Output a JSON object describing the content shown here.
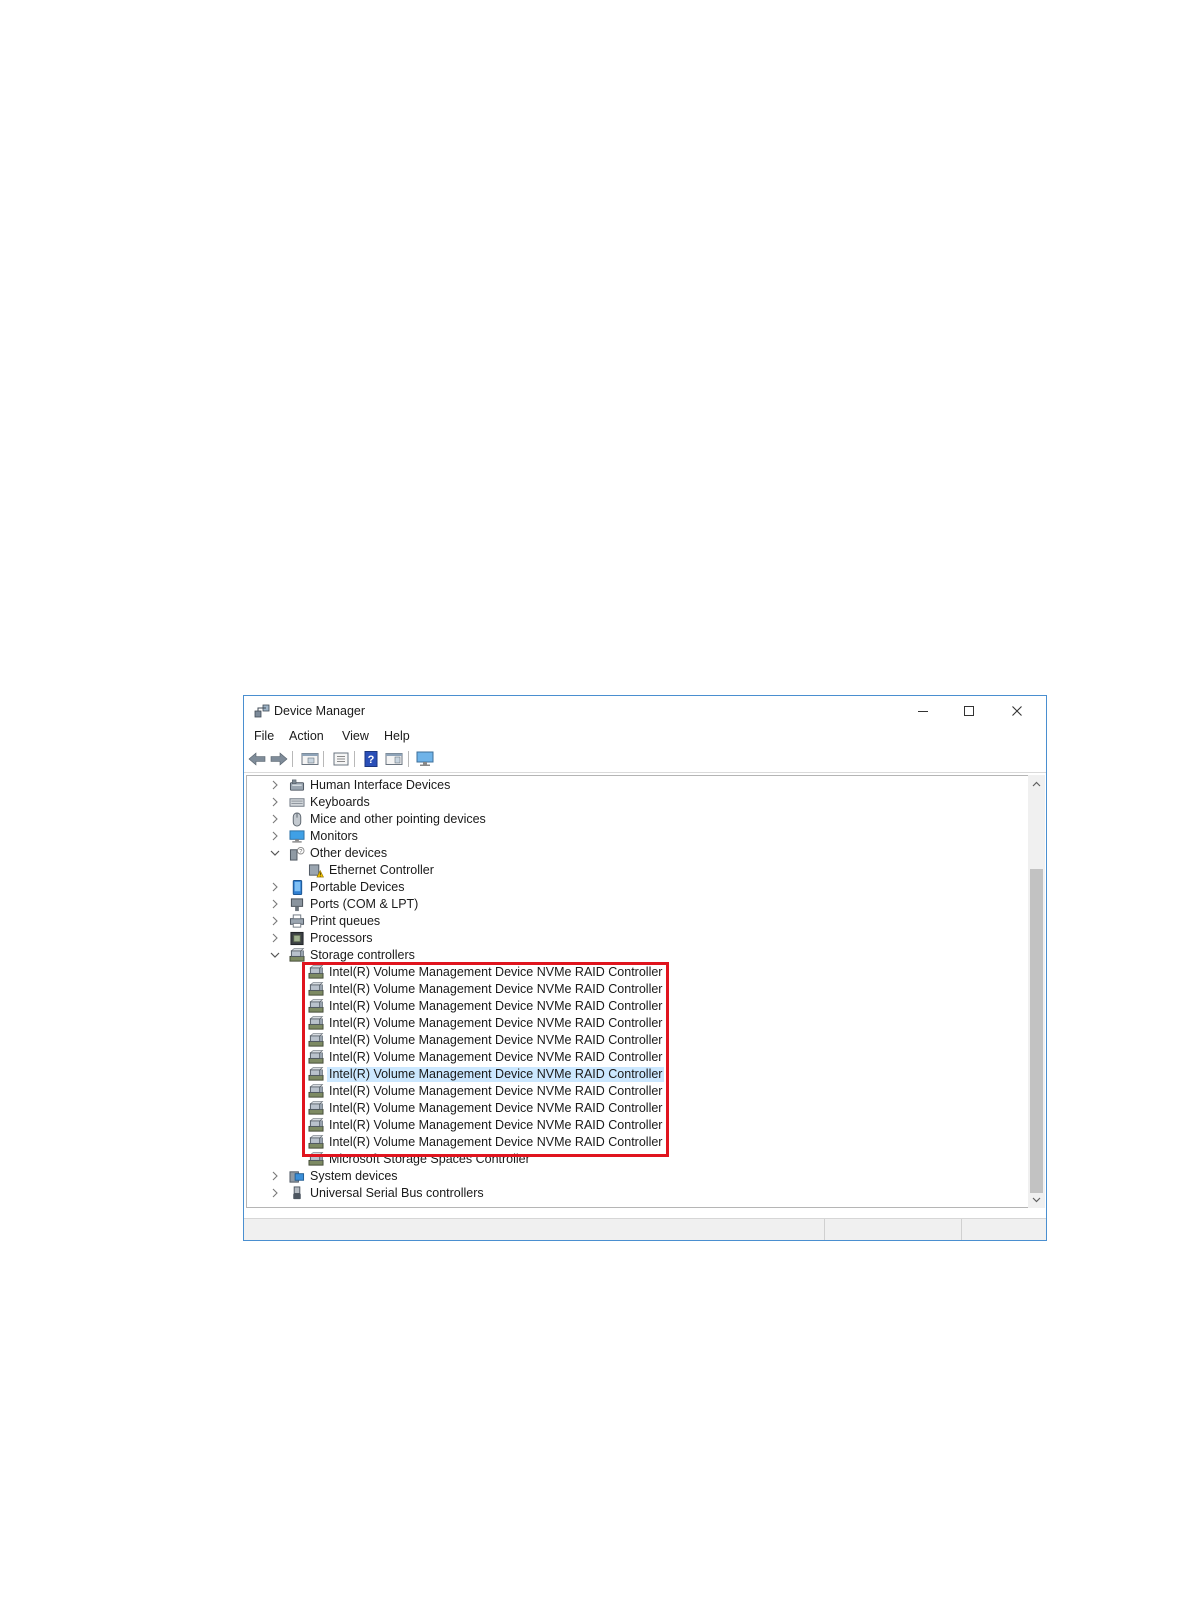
{
  "window": {
    "title": "Device Manager",
    "minimize_label": "Minimize",
    "maximize_label": "Maximize",
    "close_label": "Close"
  },
  "menu": [
    {
      "label": "File"
    },
    {
      "label": "Action"
    },
    {
      "label": "View"
    },
    {
      "label": "Help"
    }
  ],
  "toolbar": [
    {
      "icon": "back-icon"
    },
    {
      "icon": "forward-icon"
    },
    {
      "icon": "show-hide-console-tree-icon"
    },
    {
      "icon": "properties-icon"
    },
    {
      "icon": "help-icon"
    },
    {
      "icon": "show-action-pane-icon"
    },
    {
      "icon": "monitor-icon"
    }
  ],
  "tree": [
    {
      "label": "Human Interface Devices",
      "icon": "hid-icon",
      "level": 0,
      "expander": "collapsed"
    },
    {
      "label": "Keyboards",
      "icon": "keyboard-icon",
      "level": 0,
      "expander": "collapsed"
    },
    {
      "label": "Mice and other pointing devices",
      "icon": "mouse-icon",
      "level": 0,
      "expander": "collapsed"
    },
    {
      "label": "Monitors",
      "icon": "monitor-icon",
      "level": 0,
      "expander": "collapsed"
    },
    {
      "label": "Other devices",
      "icon": "unknown-device-icon",
      "level": 0,
      "expander": "expanded"
    },
    {
      "label": "Ethernet Controller",
      "icon": "warning-device-icon",
      "level": 1,
      "expander": "none"
    },
    {
      "label": "Portable Devices",
      "icon": "portable-device-icon",
      "level": 0,
      "expander": "collapsed"
    },
    {
      "label": "Ports (COM & LPT)",
      "icon": "port-icon",
      "level": 0,
      "expander": "collapsed"
    },
    {
      "label": "Print queues",
      "icon": "printer-icon",
      "level": 0,
      "expander": "collapsed"
    },
    {
      "label": "Processors",
      "icon": "processor-icon",
      "level": 0,
      "expander": "collapsed"
    },
    {
      "label": "Storage controllers",
      "icon": "storage-controller-icon",
      "level": 0,
      "expander": "expanded"
    },
    {
      "label": "Intel(R) Volume Management Device NVMe RAID Controller",
      "icon": "storage-controller-icon",
      "level": 1,
      "expander": "none"
    },
    {
      "label": "Intel(R) Volume Management Device NVMe RAID Controller",
      "icon": "storage-controller-icon",
      "level": 1,
      "expander": "none"
    },
    {
      "label": "Intel(R) Volume Management Device NVMe RAID Controller",
      "icon": "storage-controller-icon",
      "level": 1,
      "expander": "none"
    },
    {
      "label": "Intel(R) Volume Management Device NVMe RAID Controller",
      "icon": "storage-controller-icon",
      "level": 1,
      "expander": "none"
    },
    {
      "label": "Intel(R) Volume Management Device NVMe RAID Controller",
      "icon": "storage-controller-icon",
      "level": 1,
      "expander": "none"
    },
    {
      "label": "Intel(R) Volume Management Device NVMe RAID Controller",
      "icon": "storage-controller-icon",
      "level": 1,
      "expander": "none"
    },
    {
      "label": "Intel(R) Volume Management Device NVMe RAID Controller",
      "icon": "storage-controller-icon",
      "level": 1,
      "expander": "none",
      "selected": true
    },
    {
      "label": "Intel(R) Volume Management Device NVMe RAID Controller",
      "icon": "storage-controller-icon",
      "level": 1,
      "expander": "none"
    },
    {
      "label": "Intel(R) Volume Management Device NVMe RAID Controller",
      "icon": "storage-controller-icon",
      "level": 1,
      "expander": "none"
    },
    {
      "label": "Intel(R) Volume Management Device NVMe RAID Controller",
      "icon": "storage-controller-icon",
      "level": 1,
      "expander": "none"
    },
    {
      "label": "Intel(R) Volume Management Device NVMe RAID Controller",
      "icon": "storage-controller-icon",
      "level": 1,
      "expander": "none"
    },
    {
      "label": "Microsoft Storage Spaces Controller",
      "icon": "storage-controller-icon",
      "level": 1,
      "expander": "none"
    },
    {
      "label": "System devices",
      "icon": "system-devices-icon",
      "level": 0,
      "expander": "collapsed"
    },
    {
      "label": "Universal Serial Bus controllers",
      "icon": "usb-icon",
      "level": 0,
      "expander": "collapsed"
    }
  ],
  "highlight": {
    "color": "#e0141e",
    "covers": "Intel(R) Volume Management Device NVMe RAID Controller"
  },
  "colors": {
    "window_border": "#4a8fd0",
    "selection": "#cce8ff",
    "highlight_box": "#e0141e"
  }
}
